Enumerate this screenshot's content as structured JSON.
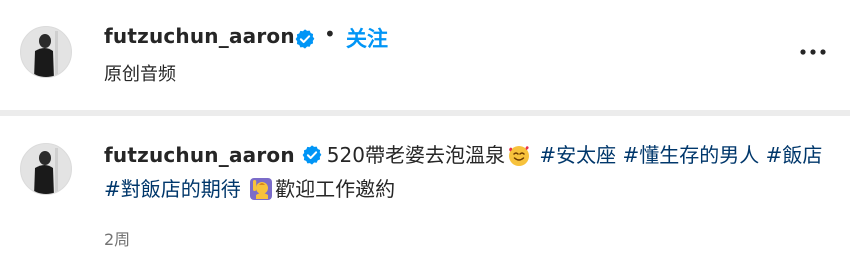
{
  "header": {
    "username": "futzuchun_aaron",
    "follow_label": "关注",
    "separator": "•",
    "subtitle": "原创音频"
  },
  "caption": {
    "username": "futzuchun_aaron",
    "text_intro": "520帶老婆去泡溫泉",
    "hashtags": [
      "#安太座",
      "#懂生存的男人",
      "#飯店",
      "#對飯店的期待"
    ],
    "text_outro": "歡迎工作邀約",
    "timestamp": "2周"
  },
  "icons": {
    "verified": "verified-badge-icon",
    "more": "more-horizontal-icon",
    "emoji_1": "smiling-face-with-hearts-emoji",
    "emoji_2": "person-raising-hand-emoji"
  },
  "colors": {
    "link_blue": "#0095f6",
    "hashtag": "#00376b",
    "muted": "#737373"
  }
}
